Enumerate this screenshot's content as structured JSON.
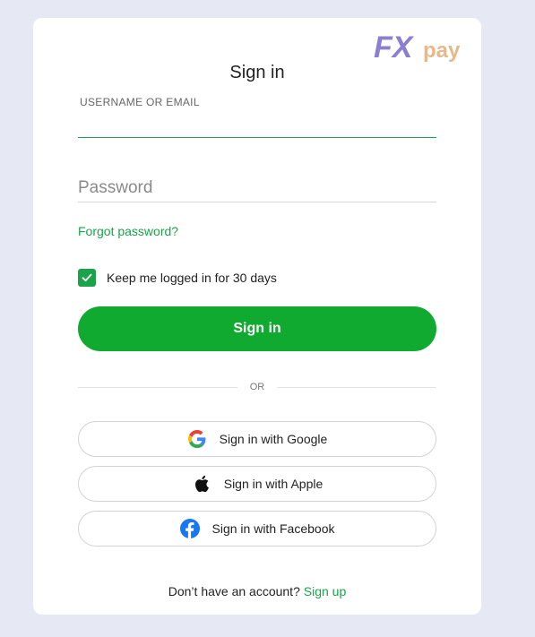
{
  "brand": {
    "logo_fx": "FX",
    "logo_pay": "pay",
    "colors": {
      "fx": "#8a7fd1",
      "pay": "#e5b98a",
      "accent": "#1aa34a"
    }
  },
  "form": {
    "title": "Sign in",
    "username_label": "USERNAME OR EMAIL",
    "username_value": "",
    "password_placeholder": "Password",
    "forgot_label": "Forgot password?",
    "remember_label": "Keep me logged in for 30 days",
    "remember_checked": true,
    "submit_label": "Sign in",
    "divider_label": "OR"
  },
  "social": {
    "google": {
      "label": "Sign in with Google",
      "icon": "google-icon"
    },
    "apple": {
      "label": "Sign in with Apple",
      "icon": "apple-icon"
    },
    "facebook": {
      "label": "Sign in with Facebook",
      "icon": "facebook-icon"
    }
  },
  "footer": {
    "prompt": "Don’t have an account?",
    "signup_label": "Sign up"
  }
}
